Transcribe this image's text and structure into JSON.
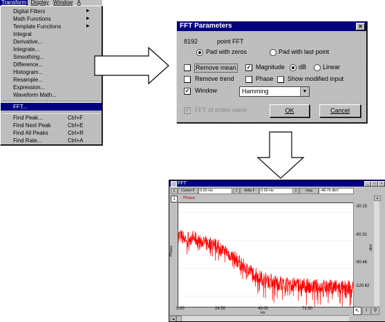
{
  "menubar": {
    "items": [
      "Transform",
      "Display",
      "Window",
      "A"
    ]
  },
  "transform_menu": {
    "items": [
      {
        "label": "Digital Filters",
        "submenu": true
      },
      {
        "label": "Math Functions",
        "submenu": true
      },
      {
        "label": "Template Functions",
        "submenu": true
      },
      {
        "label": "Integral"
      },
      {
        "label": "Derivative..."
      },
      {
        "label": "Integrate..."
      },
      {
        "label": "Smoothing..."
      },
      {
        "label": "Difference..."
      },
      {
        "label": "Histogram..."
      },
      {
        "label": "Resample..."
      },
      {
        "label": "Expression..."
      },
      {
        "label": "Waveform Math..."
      },
      {
        "label": "FFT...",
        "selected": true
      },
      {
        "label": "Find Peak...",
        "shortcut": "Ctrl+F"
      },
      {
        "label": "Find Next Peak",
        "shortcut": "Ctrl+E"
      },
      {
        "label": "Find All Peaks",
        "shortcut": "Ctrl+R"
      },
      {
        "label": "Find Rate...",
        "shortcut": "Ctrl+A"
      }
    ]
  },
  "fft_dialog": {
    "title": "FFT Parameters",
    "close_glyph": "✕",
    "points_value": "8192",
    "points_label": "point FFT",
    "pad_zeros": "Pad with zeros",
    "pad_last": "Pad with last point",
    "remove_mean": "Remove mean",
    "magnitude": "Magnitude",
    "db": "dB",
    "linear": "Linear",
    "remove_trend": "Remove trend",
    "phase": "Phase",
    "show_modified": "Show modified input",
    "window": "Window",
    "window_type": "Hamming",
    "fft_entire": "FFT of entire wave",
    "ok": "OK",
    "cancel": "Cancel",
    "check_glyph": "✓",
    "dropdown_glyph": "▼"
  },
  "plot_window": {
    "title": "FFT",
    "toolbar": {
      "cursor_label": "Cursor F",
      "cursor_value": "0.00 Hz",
      "delta_label": "delta F",
      "delta_value": "0.00 Hz",
      "mag_label": "mag",
      "mag_value": "-48.76 dbV"
    },
    "channel_number": "1",
    "channel_name": "Phase",
    "y_axis_label": "dbV",
    "x_axis_label": "Hz",
    "left_axis_label": "Phase",
    "y_ticks": [
      "-30.15",
      "-60.31",
      "-90.46",
      "-120.62"
    ],
    "x_ticks": [
      "0.00",
      "24.50",
      "49.00",
      "73.50"
    ],
    "trace_color": "#ff0000"
  },
  "chart_data": {
    "type": "line",
    "xlabel": "Hz",
    "ylabel": "dbV",
    "xlim": [
      0,
      98
    ],
    "ylim": [
      -132,
      -20
    ],
    "series": [
      {
        "points": [
          [
            0,
            -55
          ],
          [
            4,
            -58
          ],
          [
            8,
            -57
          ],
          [
            12,
            -62
          ],
          [
            16,
            -64
          ],
          [
            20,
            -64
          ],
          [
            24,
            -70
          ],
          [
            28,
            -74
          ],
          [
            32,
            -80
          ],
          [
            36,
            -87
          ],
          [
            40,
            -93
          ],
          [
            44,
            -98
          ],
          [
            48,
            -102
          ],
          [
            52,
            -104
          ],
          [
            56,
            -106
          ],
          [
            60,
            -108
          ],
          [
            64,
            -108
          ],
          [
            68,
            -108
          ],
          [
            72,
            -109
          ],
          [
            76,
            -110
          ],
          [
            80,
            -110
          ],
          [
            84,
            -110
          ],
          [
            88,
            -111
          ],
          [
            92,
            -111
          ],
          [
            97,
            -111
          ]
        ]
      }
    ]
  }
}
